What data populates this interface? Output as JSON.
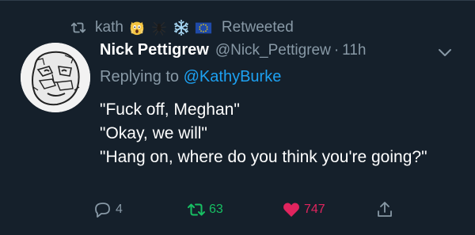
{
  "retweet_bar": {
    "user": "kath",
    "emoji_icons": [
      "scream-emoji",
      "spider-emoji",
      "snowflake-emoji",
      "eu-flag-emoji"
    ],
    "label": "Retweeted"
  },
  "tweet": {
    "display_name": "Nick Pettigrew",
    "handle": "@Nick_Pettigrew",
    "separator": "·",
    "time": "11h",
    "replying_prefix": "Replying to",
    "replying_to": "@KathyBurke",
    "lines": [
      "\"Fuck off, Meghan\"",
      "\"Okay, we will\"",
      "\"Hang on, where do you think you're going?\""
    ]
  },
  "actions": {
    "reply_count": "4",
    "retweet_count": "63",
    "like_count": "747"
  },
  "colors": {
    "background": "#15202b",
    "muted": "#8899a6",
    "link": "#1da1f2",
    "retweet_active": "#17bf63",
    "like_active": "#e0245e"
  }
}
